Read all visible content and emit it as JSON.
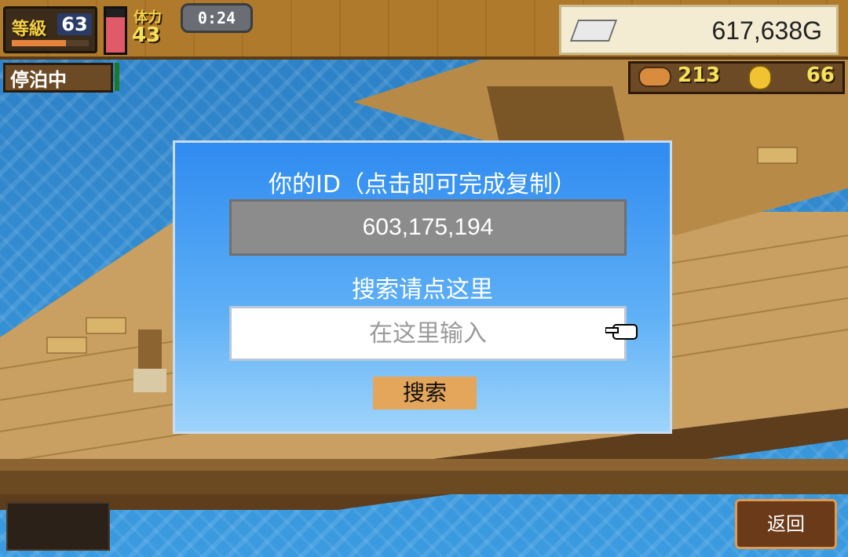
{
  "hud": {
    "level_label": "等級",
    "level_value": "63",
    "exp_percent": 70,
    "stamina_percent": 80,
    "hp_label": "体力",
    "hp_value": "43",
    "timer": "0:24",
    "gold": "617,638G",
    "status": "停泊中",
    "food": "213",
    "coins": "66"
  },
  "modal": {
    "title": "你的ID（点击即可完成复制）",
    "id_value": "603,175,194",
    "search_title": "搜索请点这里",
    "search_placeholder": "在这里输入",
    "search_button": "搜索"
  },
  "back_button": "返回",
  "colors": {
    "modal_bg": "#2f8bf0",
    "button_bg": "#e4a65a",
    "accent_text": "#f6e15a"
  }
}
